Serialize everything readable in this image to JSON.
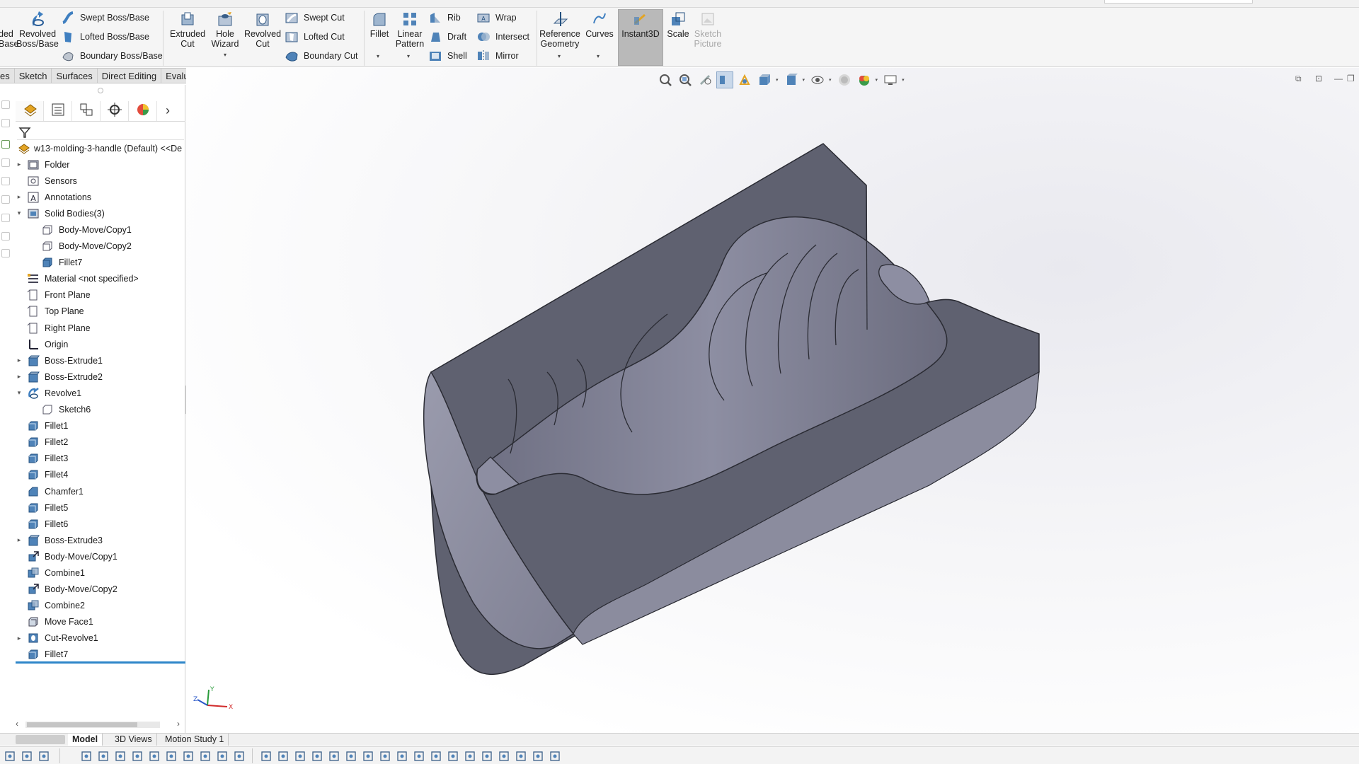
{
  "ribbon": {
    "items": {
      "extruded_boss_frag": "ded\nBase",
      "revolved_boss": "Revolved\nBoss/Base",
      "swept_boss": "Swept Boss/Base",
      "lofted_boss": "Lofted Boss/Base",
      "boundary_boss": "Boundary Boss/Base",
      "extruded_cut": "Extruded\nCut",
      "hole_wizard": "Hole\nWizard",
      "revolved_cut": "Revolved\nCut",
      "swept_cut": "Swept Cut",
      "lofted_cut": "Lofted Cut",
      "boundary_cut": "Boundary Cut",
      "fillet": "Fillet",
      "linear_pattern": "Linear\nPattern",
      "rib": "Rib",
      "draft": "Draft",
      "shell": "Shell",
      "wrap": "Wrap",
      "intersect": "Intersect",
      "mirror": "Mirror",
      "reference_geometry": "Reference\nGeometry",
      "curves": "Curves",
      "instant3d": "Instant3D",
      "scale": "Scale",
      "sketch_picture": "Sketch\nPicture"
    },
    "dropdown_glyph": "▾"
  },
  "tabs": {
    "features_frag": "es",
    "sketch": "Sketch",
    "surfaces": "Surfaces",
    "direct_editing": "Direct Editing",
    "evaluate": "Evaluate"
  },
  "feature_tree": {
    "more_glyph": "›",
    "root": "w13-molding-3-handle (Default) <<De",
    "nodes": [
      {
        "label": "Folder",
        "level": 1,
        "arrow": "▸",
        "icon": "folder-icon"
      },
      {
        "label": "Sensors",
        "level": 1,
        "arrow": "",
        "icon": "sensors-icon"
      },
      {
        "label": "Annotations",
        "level": 1,
        "arrow": "▸",
        "icon": "annotations-icon"
      },
      {
        "label": "Solid Bodies(3)",
        "level": 1,
        "arrow": "▾",
        "icon": "solid-bodies-folder-icon"
      },
      {
        "label": "Body-Move/Copy1",
        "level": 2,
        "arrow": "",
        "icon": "body-outline-icon"
      },
      {
        "label": "Body-Move/Copy2",
        "level": 2,
        "arrow": "",
        "icon": "body-outline-icon"
      },
      {
        "label": "Fillet7",
        "level": 2,
        "arrow": "",
        "icon": "body-solid-icon"
      },
      {
        "label": "Material <not specified>",
        "level": 1,
        "arrow": "",
        "icon": "material-icon"
      },
      {
        "label": "Front Plane",
        "level": 1,
        "arrow": "",
        "icon": "plane-icon"
      },
      {
        "label": "Top Plane",
        "level": 1,
        "arrow": "",
        "icon": "plane-icon"
      },
      {
        "label": "Right Plane",
        "level": 1,
        "arrow": "",
        "icon": "plane-icon"
      },
      {
        "label": "Origin",
        "level": 1,
        "arrow": "",
        "icon": "origin-icon"
      },
      {
        "label": "Boss-Extrude1",
        "level": 1,
        "arrow": "▸",
        "icon": "boss-extrude-icon"
      },
      {
        "label": "Boss-Extrude2",
        "level": 1,
        "arrow": "▸",
        "icon": "boss-extrude-icon"
      },
      {
        "label": "Revolve1",
        "level": 1,
        "arrow": "▾",
        "icon": "revolve-icon"
      },
      {
        "label": "Sketch6",
        "level": 2,
        "arrow": "",
        "icon": "sketch-icon"
      },
      {
        "label": "Fillet1",
        "level": 1,
        "arrow": "",
        "icon": "fillet-icon"
      },
      {
        "label": "Fillet2",
        "level": 1,
        "arrow": "",
        "icon": "fillet-icon"
      },
      {
        "label": "Fillet3",
        "level": 1,
        "arrow": "",
        "icon": "fillet-icon"
      },
      {
        "label": "Fillet4",
        "level": 1,
        "arrow": "",
        "icon": "fillet-icon"
      },
      {
        "label": "Chamfer1",
        "level": 1,
        "arrow": "",
        "icon": "chamfer-icon"
      },
      {
        "label": "Fillet5",
        "level": 1,
        "arrow": "",
        "icon": "fillet-icon"
      },
      {
        "label": "Fillet6",
        "level": 1,
        "arrow": "",
        "icon": "fillet-icon"
      },
      {
        "label": "Boss-Extrude3",
        "level": 1,
        "arrow": "▸",
        "icon": "boss-extrude-icon"
      },
      {
        "label": "Body-Move/Copy1",
        "level": 1,
        "arrow": "",
        "icon": "move-copy-icon"
      },
      {
        "label": "Combine1",
        "level": 1,
        "arrow": "",
        "icon": "combine-icon"
      },
      {
        "label": "Body-Move/Copy2",
        "level": 1,
        "arrow": "",
        "icon": "move-copy-icon"
      },
      {
        "label": "Combine2",
        "level": 1,
        "arrow": "",
        "icon": "combine-icon"
      },
      {
        "label": "Move Face1",
        "level": 1,
        "arrow": "",
        "icon": "move-face-icon"
      },
      {
        "label": "Cut-Revolve1",
        "level": 1,
        "arrow": "▸",
        "icon": "cut-revolve-icon"
      },
      {
        "label": "Fillet7",
        "level": 1,
        "arrow": "",
        "icon": "fillet-icon"
      }
    ],
    "scroll_left": "‹",
    "scroll_right": "›",
    "splitter_glyph": "‹"
  },
  "bottom_tabs": {
    "model": "Model",
    "views3d": "3D Views",
    "motion": "Motion Study 1"
  },
  "viewport": {
    "triad": {
      "x": "X",
      "y": "Y",
      "z": "Z"
    },
    "window_controls": [
      "⧉",
      "⊡",
      "—",
      "❐"
    ]
  },
  "colors": {
    "body_top": "#5f6170",
    "body_front": "#9a9bad",
    "body_cavity": "#7c7d8f",
    "accent": "#2e86c9",
    "active_button": "#b9b9b9"
  }
}
